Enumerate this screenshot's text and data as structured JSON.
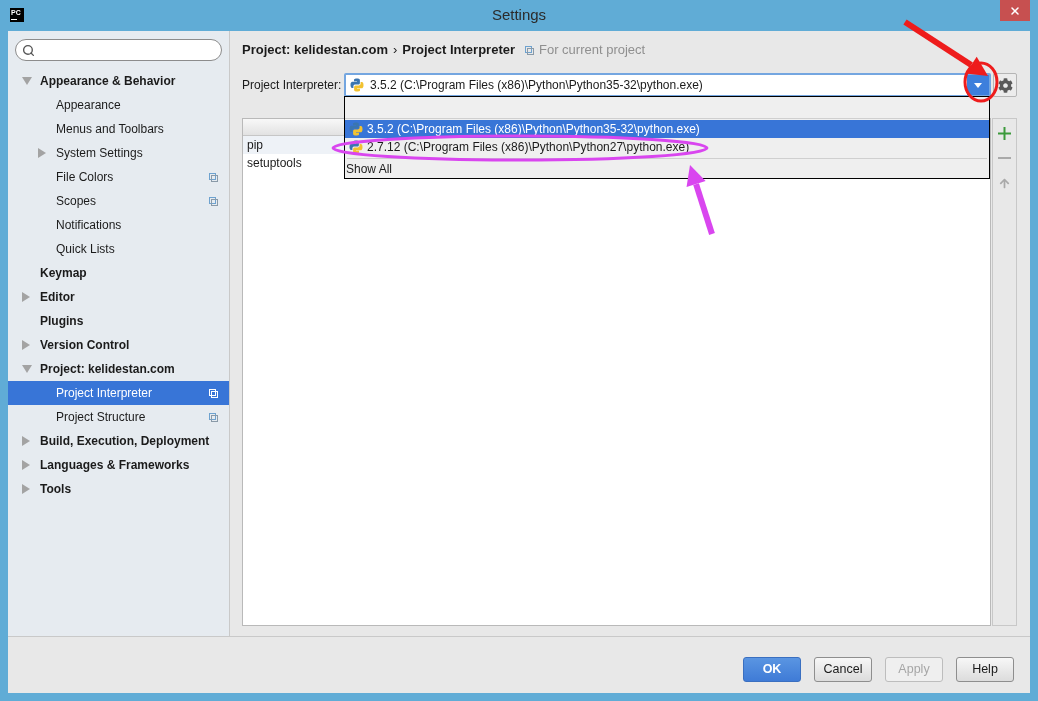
{
  "window": {
    "logo": "PC",
    "title": "Settings"
  },
  "sidebar": {
    "items": [
      {
        "label": "Appearance & Behavior",
        "expanded": true,
        "selected": false,
        "per_project": false,
        "children": [
          {
            "label": "Appearance",
            "selected": false,
            "per_project": false
          },
          {
            "label": "Menus and Toolbars",
            "selected": false,
            "per_project": false
          },
          {
            "label": "System Settings",
            "expanded": false,
            "selected": false,
            "per_project": false
          },
          {
            "label": "File Colors",
            "selected": false,
            "per_project": true
          },
          {
            "label": "Scopes",
            "selected": false,
            "per_project": true
          },
          {
            "label": "Notifications",
            "selected": false,
            "per_project": false
          },
          {
            "label": "Quick Lists",
            "selected": false,
            "per_project": false
          }
        ]
      },
      {
        "label": "Keymap",
        "selected": false,
        "per_project": false
      },
      {
        "label": "Editor",
        "expanded": false,
        "selected": false,
        "per_project": false
      },
      {
        "label": "Plugins",
        "selected": false,
        "per_project": false
      },
      {
        "label": "Version Control",
        "expanded": false,
        "selected": false,
        "per_project": false
      },
      {
        "label": "Project: kelidestan.com",
        "expanded": true,
        "selected": false,
        "per_project": false,
        "children": [
          {
            "label": "Project Interpreter",
            "selected": true,
            "per_project": true
          },
          {
            "label": "Project Structure",
            "selected": false,
            "per_project": true
          }
        ]
      },
      {
        "label": "Build, Execution, Deployment",
        "expanded": false,
        "selected": false,
        "per_project": false
      },
      {
        "label": "Languages & Frameworks",
        "expanded": false,
        "selected": false,
        "per_project": false
      },
      {
        "label": "Tools",
        "expanded": false,
        "selected": false,
        "per_project": false
      }
    ]
  },
  "breadcrumb": {
    "items": [
      "Project: kelidestan.com",
      "Project Interpreter"
    ],
    "separator": "›",
    "scope_note": "For current project"
  },
  "interpreter": {
    "label": "Project Interpreter:",
    "value": "3.5.2 (C:\\Program Files (x86)\\Python\\Python35-32\\python.exe)",
    "expanded": true,
    "options": [
      {
        "label": "3.5.2 (C:\\Program Files (x86)\\Python\\Python35-32\\python.exe)",
        "selected": true
      },
      {
        "label": "2.7.12 (C:\\Program Files (x86)\\Python\\Python27\\python.exe)",
        "selected": false
      }
    ],
    "show_all": "Show All"
  },
  "packages": {
    "rows": [
      {
        "column_1": "pip",
        "selected": true
      },
      {
        "column_1": "setuptools",
        "selected": false
      }
    ]
  },
  "table_toolbar": [
    {
      "kind": "add",
      "disabled": false
    },
    {
      "kind": "remove",
      "disabled": true
    },
    {
      "kind": "upgrade",
      "disabled": true
    }
  ],
  "buttons": [
    {
      "label": "OK",
      "primary": true,
      "disabled": false
    },
    {
      "label": "Cancel",
      "primary": false,
      "disabled": false
    },
    {
      "label": "Apply",
      "primary": false,
      "disabled": true
    },
    {
      "label": "Help",
      "primary": false,
      "disabled": false
    }
  ],
  "annotations": [
    {
      "kind": "arrow",
      "color": "#ee1c1c"
    },
    {
      "kind": "ellipse",
      "color": "#ee1c1c"
    },
    {
      "kind": "ellipse",
      "color": "#d946ef"
    },
    {
      "kind": "arrow",
      "color": "#d946ef"
    }
  ]
}
